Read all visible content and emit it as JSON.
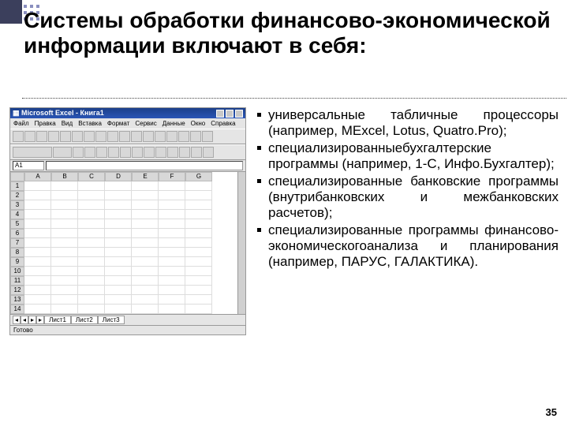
{
  "title": "Системы обработки финансово-экономической информации включают в себя:",
  "bullets": [
    "универсальные табличные процессоры (например, MExcel, Lotus, Quatro.Pro);",
    "специализированныебухгалтерские программы (например, 1-С, Инфо.Бухгалтер);",
    "специализированные банковские программы (внутрибанковских и межбанковских расчетов);",
    "специализированные программы финансово-экономическогоанализа и планирования (например, ПАРУС, ГАЛАКТИКА)."
  ],
  "page_number": "35",
  "excel": {
    "title": "Microsoft Excel - Книга1",
    "menu": [
      "Файл",
      "Правка",
      "Вид",
      "Вставка",
      "Формат",
      "Сервис",
      "Данные",
      "Окно",
      "Справка"
    ],
    "namebox": "A1",
    "columns": [
      "A",
      "B",
      "C",
      "D",
      "E",
      "F",
      "G"
    ],
    "rows": [
      "1",
      "2",
      "3",
      "4",
      "5",
      "6",
      "7",
      "8",
      "9",
      "10",
      "11",
      "12",
      "13",
      "14"
    ],
    "tabs": [
      "Лист1",
      "Лист2",
      "Лист3"
    ],
    "status": "Готово"
  }
}
